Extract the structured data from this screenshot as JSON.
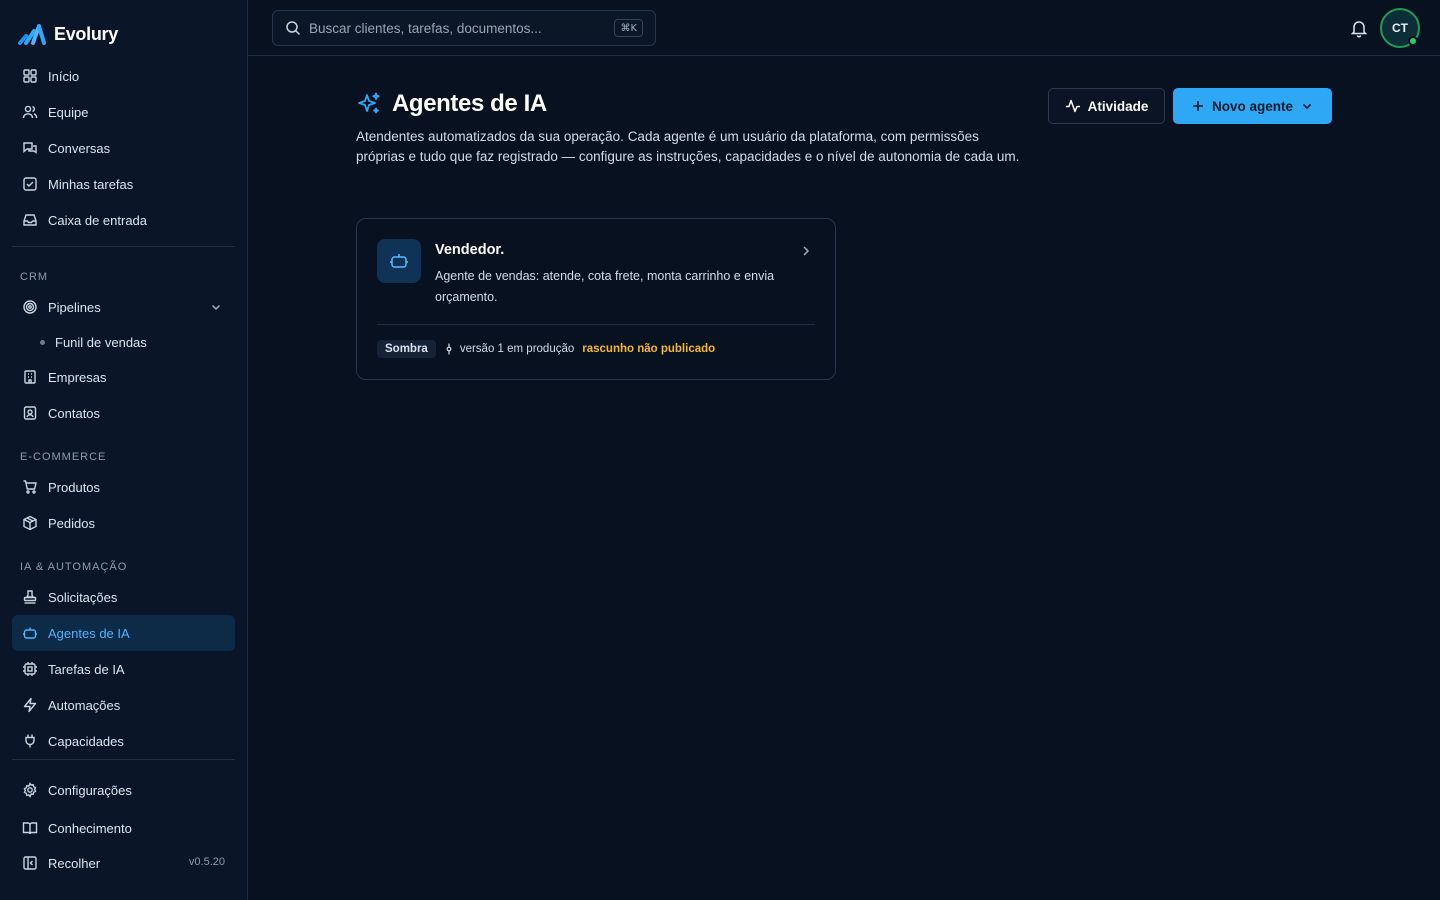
{
  "brand": {
    "name": "Evolury"
  },
  "search": {
    "placeholder": "Buscar clientes, tarefas, documentos...",
    "shortcut": "⌘K"
  },
  "user": {
    "initials": "CT"
  },
  "sidebar": {
    "main_items": [
      {
        "label": "Início",
        "icon": "home-grid-icon"
      },
      {
        "label": "Equipe",
        "icon": "users-icon"
      },
      {
        "label": "Conversas",
        "icon": "chat-icon"
      },
      {
        "label": "Minhas tarefas",
        "icon": "task-check-icon"
      },
      {
        "label": "Caixa de entrada",
        "icon": "inbox-icon"
      }
    ],
    "crm_label": "CRM",
    "crm_items": [
      {
        "label": "Pipelines",
        "icon": "target-icon"
      },
      {
        "label": "Funil de vendas"
      },
      {
        "label": "Empresas",
        "icon": "building-icon"
      },
      {
        "label": "Contatos",
        "icon": "contact-icon"
      }
    ],
    "ecommerce_label": "E-COMMERCE",
    "ecommerce_items": [
      {
        "label": "Produtos",
        "icon": "cart-icon"
      },
      {
        "label": "Pedidos",
        "icon": "package-icon"
      }
    ],
    "ai_label": "IA & AUTOMAÇÃO",
    "ai_items": [
      {
        "label": "Solicitações",
        "icon": "stamp-icon"
      },
      {
        "label": "Agentes de IA",
        "icon": "bot-icon"
      },
      {
        "label": "Tarefas de IA",
        "icon": "cpu-icon"
      },
      {
        "label": "Automações",
        "icon": "zap-icon"
      },
      {
        "label": "Capacidades",
        "icon": "plug-icon"
      }
    ],
    "bottom_items": [
      {
        "label": "Configurações",
        "icon": "gear-icon"
      },
      {
        "label": "Conhecimento",
        "icon": "book-icon"
      },
      {
        "label": "Recolher",
        "icon": "collapse-icon"
      }
    ],
    "version": "v0.5.20"
  },
  "page": {
    "title": "Agentes de IA",
    "description": "Atendentes automatizados da sua operação. Cada agente é um usuário da plataforma, com permissões próprias e tudo que faz registrado — configure as instruções, capacidades e o nível de autonomia de cada um.",
    "activity_button": "Atividade",
    "new_agent_button": "Novo agente"
  },
  "agents": [
    {
      "name": "Vendedor.",
      "description": "Agente de vendas: atende, cota frete, monta carrinho e envia orçamento.",
      "mode_tag": "Sombra",
      "version_text": "versão 1 em produção",
      "draft_text": "rascunho não publicado"
    }
  ],
  "colors": {
    "accent": "#2ea8f5",
    "background": "#07111f",
    "sidebar": "#0a1628",
    "draft": "#f5b82e",
    "online": "#2ecc71"
  }
}
